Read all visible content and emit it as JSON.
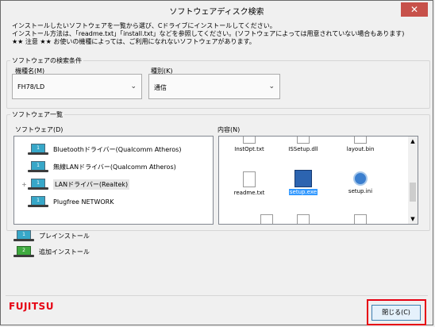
{
  "window": {
    "title": "ソフトウェアディスク検索",
    "close_glyph": "✕"
  },
  "intro": [
    "インストールしたいソフトウェアを一覧から選び、Cドライブにインストールしてください。",
    "インストール方法は、「readme.txt」「install.txt」などを参照してください。(ソフトウェアによっては用意されていない場合もあります)",
    "★★ 注意 ★★ お使いの機種によっては、ご利用になれないソフトウェアがあります。"
  ],
  "search": {
    "legend": "ソフトウェアの検索条件",
    "model_label": "機種名(M)",
    "model_value": "FH78/LD",
    "type_label": "種別(K)",
    "type_value": "通信",
    "chevron": "⌄"
  },
  "list": {
    "legend": "ソフトウェア一覧",
    "software_label": "ソフトウェア(D)",
    "content_label": "内容(N)",
    "items": [
      {
        "label": "Bluetoothドライバー(Qualcomm Atheros)",
        "badge": "1",
        "expander": ""
      },
      {
        "label": "無線LANドライバー(Qualcomm Atheros)",
        "badge": "1",
        "expander": ""
      },
      {
        "label": "LANドライバー(Realtek)",
        "badge": "1",
        "expander": "+"
      },
      {
        "label": "Plugfree NETWORK",
        "badge": "1",
        "expander": ""
      }
    ],
    "files": [
      {
        "name": "InstOpt.txt"
      },
      {
        "name": "ISSetup.dll"
      },
      {
        "name": "layout.bin"
      },
      {
        "name": "readme.txt"
      },
      {
        "name": "setup.exe"
      },
      {
        "name": "setup.ini"
      }
    ],
    "scroll_up": "▲",
    "scroll_down": "▼"
  },
  "legend_items": [
    {
      "badge": "1",
      "label": "プレインストール",
      "color": "#37a7c8"
    },
    {
      "badge": "2",
      "label": "追加インストール",
      "color": "#3faa3f"
    }
  ],
  "brand": "FUJITSU",
  "close_button": "閉じる(C)"
}
